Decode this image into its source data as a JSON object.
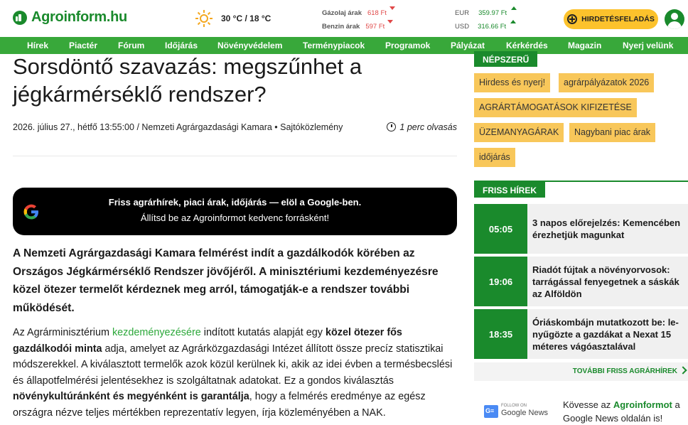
{
  "header": {
    "logo": "Agroinform.hu",
    "weather": {
      "temp": "30 °C / 18 °C",
      "icon": "sun-icon"
    },
    "fuel": [
      {
        "label": "Gázolaj árak",
        "value": "618 Ft",
        "trend": "down"
      },
      {
        "label": "Benzin árak",
        "value": "597 Ft",
        "trend": "down"
      }
    ],
    "fx": [
      {
        "label": "EUR",
        "value": "359.97 Ft",
        "trend": "up"
      },
      {
        "label": "USD",
        "value": "316.66 Ft",
        "trend": "up"
      }
    ],
    "ad_button": "HIRDETÉSFELADÁS"
  },
  "nav": [
    "Hírek",
    "Piactér",
    "Fórum",
    "Időjárás",
    "Növényvédelem",
    "Terménypiacok",
    "Programok",
    "Pályázat",
    "Kérkérdés",
    "Magazin",
    "Nyerj velünk"
  ],
  "article": {
    "title": "Sorsdöntő szavazás: megszűnhet a jégkármérséklő rendszer?",
    "meta": "2026. július 27., hétfő 13:55:00 / Nemzeti Agrárgazdasági Kamara  •  Sajtóközlemény",
    "read_time": "1 perc olvasás",
    "google_box": {
      "line1": "Friss agrárhírek, piaci árak, időjárás — elöl a Google-ben.",
      "line2": "Állítsd be az Agroinformot kedvenc forrásként!"
    },
    "lead": "A Nemzeti Agrárgazdasági Kamara felmérést indít a gazdálkodók körében az Országos Jégkármérséklő Rendszer jövőjéről. A minisztériumi kezdeményezésre közel ötezer termelőt kérdeznek meg arról, támogatják-e a rendszer további működését.",
    "body": {
      "p1a": "Az Agrárminisztérium ",
      "p1link": "kezdeményezésére",
      "p1b": " indított kutatás alapját egy ",
      "p1bold": "közel ötezer fős gazdálkodói minta",
      "p1c": " adja, amelyet az Agrárközgazdasági Intézet állított össze precíz statisztikai módszerekkel. A kiválasztott termelők azok közül kerülnek ki, akik az idei évben a termésbecslési és állapotfelmérési jelentésekhez is szolgáltatnak adatokat. Ez a gondos kiválasztás ",
      "p1bold2": "növénykultúránként és megyénként is garantálja",
      "p1d": ", hogy a felmérés eredménye az egész országra nézve teljes mértékben reprezentatív legyen, írja közleményében a NAK."
    }
  },
  "sidebar": {
    "popular_title": "NÉPSZERŰ",
    "tags": [
      "Hirdess és nyerj!",
      "agrárpályázatok 2026",
      "AGRÁRTÁMOGATÁSOK KIFIZETÉSE",
      "ÜZEMANYAGÁRAK",
      "Nagybani piac árak",
      "időjárás"
    ],
    "news_title": "FRISS HÍREK",
    "news": [
      {
        "time": "05:05",
        "text": "3 napos előrejelzés: Kemencében érezhetjük magunkat"
      },
      {
        "time": "19:06",
        "text": "Riadót fújtak a növényorvosok: tarrágással fenyegetnek a sáskák az Alföldön"
      },
      {
        "time": "18:35",
        "text": "Óriáskombájn mutatkozott be: le-nyűgözte a gazdákat a Nexat 15 méteres vágóasztalával"
      }
    ],
    "more": "TOVÁBBI FRISS AGRÁRHÍREK",
    "gnews": {
      "follow_on": "FOLLOW ON",
      "name": "Google News"
    },
    "follow_a": "Kövesse az ",
    "follow_b": "Agroinformot",
    "follow_c": " a Google News oldalán is!"
  }
}
